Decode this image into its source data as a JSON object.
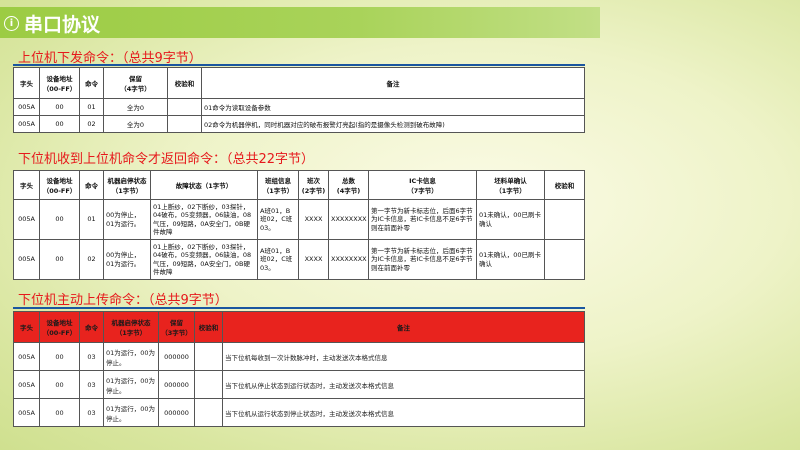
{
  "title": "串口协议",
  "section1": {
    "heading": "上位机下发命令：（总共9字节）",
    "headers": [
      "字头",
      "设备地址\n（00-FF）",
      "命令",
      "保留\n（4字节）",
      "校验和",
      "备注"
    ],
    "rows": [
      [
        "005A",
        "00",
        "01",
        "全为0",
        "",
        "01命令为读取设备参数"
      ],
      [
        "005A",
        "00",
        "02",
        "全为0",
        "",
        "02命令为机器停机，同时机器对应的破布报警灯亮起(指的是摄像头检测到破布故障)"
      ]
    ]
  },
  "section2": {
    "heading": "下位机收到上位机命令才返回命令：（总共22字节）",
    "headers": [
      "字头",
      "设备地址\n（00-FF）",
      "命令",
      "机器启停状态（1字节）",
      "故障状态（1字节）",
      "班组信息（1字节）",
      "班次\n(2字节)",
      "总数\n(4字节)",
      "IC卡信息\n（7字节）",
      "坯料单确认\n（1字节）",
      "校验和"
    ],
    "rows": [
      [
        "005A",
        "00",
        "01",
        "00为停止，01为运行。",
        "01上断纱，02下断纱，03探针，04破布，05变频器，06缺油，08气压，09短路，0A安全门，0B硬件故障",
        "A班01，B班02，C班03。",
        "XXXX",
        "XXXXXXXX",
        "第一字节为新卡标志位，后面6字节为IC卡信息，若IC卡信息不足6字节则在前面补零",
        "01未确认，00已刷卡确认",
        ""
      ],
      [
        "005A",
        "00",
        "02",
        "00为停止，01为运行。",
        "01上断纱，02下断纱，03探针，04破布，05变频器，06缺油，08气压，09短路，0A安全门，0B硬件故障",
        "A班01，B班02，C班03。",
        "XXXX",
        "XXXXXXXX",
        "第一字节为新卡标志位，后面6字节为IC卡信息，若IC卡信息不足6字节则在前面补零",
        "01未确认，00已刷卡确认",
        ""
      ]
    ]
  },
  "section3": {
    "heading": "下位机主动上传命令：（总共9字节）",
    "headers": [
      "字头",
      "设备地址\n（00-FF）",
      "命令",
      "机器启停状态\n（1字节）",
      "保留\n（3字节）",
      "校验和",
      "备注"
    ],
    "rows": [
      [
        "005A",
        "00",
        "03",
        "01为运行，00为停止。",
        "000000",
        "",
        "当下位机每收到一次计数脉冲时，主动发送次本格式信息"
      ],
      [
        "005A",
        "00",
        "03",
        "01为运行，00为停止。",
        "000000",
        "",
        "当下位机从停止状态到运行状态时，主动发送次本格式信息"
      ],
      [
        "005A",
        "00",
        "03",
        "01为运行，00为停止。",
        "000000",
        "",
        "当下位机从运行状态到停止状态时，主动发送次本格式信息"
      ]
    ]
  }
}
